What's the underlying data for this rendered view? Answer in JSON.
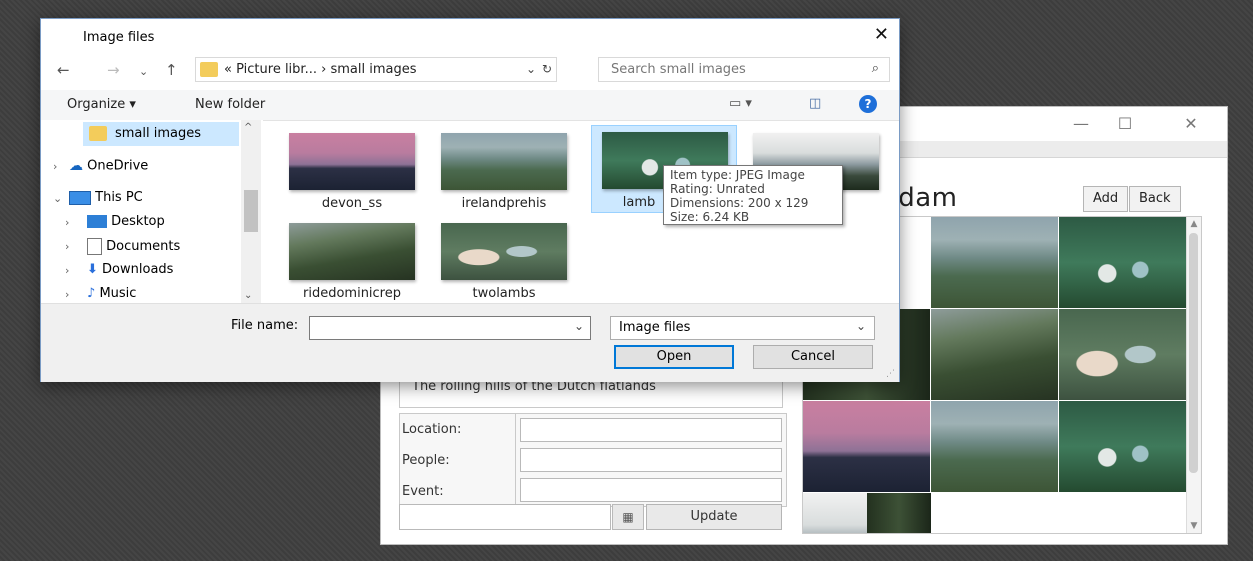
{
  "app": {
    "title": "erdam",
    "add_label": "Add",
    "back_label": "Back",
    "description": "The rolling hills of the Dutch flatlands",
    "location_label": "Location:",
    "people_label": "People:",
    "event_label": "Event:",
    "update_label": "Update",
    "window_controls": [
      "—",
      "☐",
      "✕"
    ]
  },
  "dialog": {
    "title": "Image files",
    "close_glyph": "✕",
    "address": {
      "overflow": "«",
      "crumbs": [
        "Picture libr...",
        "small images"
      ],
      "separator": "›"
    },
    "search_placeholder": "Search small images",
    "toolbar": {
      "organize_label": "Organize ▾",
      "new_folder_label": "New folder"
    },
    "nav": [
      {
        "label": "small images",
        "selected": true
      },
      {
        "label": "OneDrive"
      },
      {
        "label": "This PC"
      },
      {
        "label": "Desktop"
      },
      {
        "label": "Documents"
      },
      {
        "label": "Downloads"
      },
      {
        "label": "Music"
      }
    ],
    "files": [
      {
        "name": "devon_ss"
      },
      {
        "name": "irelandprehis"
      },
      {
        "name": "lamb"
      },
      {
        "name": ""
      },
      {
        "name": "ridedominicrep"
      },
      {
        "name": "twolambs"
      }
    ],
    "tooltip": {
      "type": "Item type: JPEG Image",
      "rating": "Rating: Unrated",
      "dimensions": "Dimensions: 200 x 129",
      "size": "Size: 6.24 KB"
    },
    "file_name_label": "File name:",
    "file_name_value": "",
    "file_type_value": "Image files",
    "open_label": "Open",
    "cancel_label": "Cancel"
  }
}
